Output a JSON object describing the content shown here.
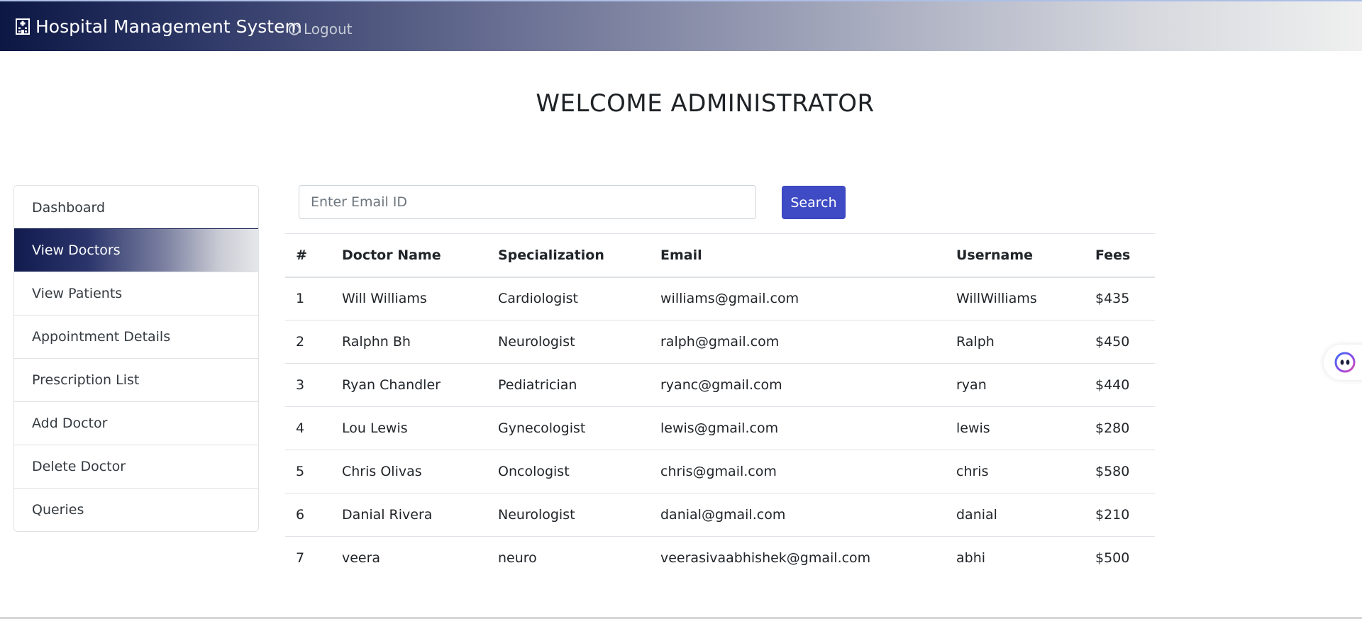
{
  "navbar": {
    "brand": "Hospital Management System",
    "brand_icon": "hospital-icon",
    "logout_label": "Logout",
    "logout_icon": "power-icon"
  },
  "welcome": "WELCOME ADMINISTRATOR",
  "sidebar": {
    "active_index": 1,
    "items": [
      {
        "label": "Dashboard"
      },
      {
        "label": "View Doctors"
      },
      {
        "label": "View Patients"
      },
      {
        "label": "Appointment Details"
      },
      {
        "label": "Prescription List"
      },
      {
        "label": "Add Doctor"
      },
      {
        "label": "Delete Doctor"
      },
      {
        "label": "Queries"
      }
    ]
  },
  "search": {
    "placeholder": "Enter Email ID",
    "value": "",
    "button_label": "Search"
  },
  "table": {
    "headers": [
      "#",
      "Doctor Name",
      "Specialization",
      "Email",
      "Username",
      "Fees"
    ],
    "rows": [
      [
        "1",
        "Will Williams",
        "Cardiologist",
        "williams@gmail.com",
        "WillWilliams",
        "$435"
      ],
      [
        "2",
        "Ralphn Bh",
        "Neurologist",
        "ralph@gmail.com",
        "Ralph",
        "$450"
      ],
      [
        "3",
        "Ryan Chandler",
        "Pediatrician",
        "ryanc@gmail.com",
        "ryan",
        "$440"
      ],
      [
        "4",
        "Lou Lewis",
        "Gynecologist",
        "lewis@gmail.com",
        "lewis",
        "$280"
      ],
      [
        "5",
        "Chris Olivas",
        "Oncologist",
        "chris@gmail.com",
        "chris",
        "$580"
      ],
      [
        "6",
        "Danial Rivera",
        "Neurologist",
        "danial@gmail.com",
        "danial",
        "$210"
      ],
      [
        "7",
        "veera",
        "neuro",
        "veerasivaabhishek@gmail.com",
        "abhi",
        "$500"
      ]
    ]
  },
  "floating_widget": {
    "icon": "assistant-face-icon"
  },
  "colors": {
    "navbar_start": "#0d1744",
    "navbar_end": "#eff0ef",
    "search_button": "#3e4bc4",
    "active_item_start": "#111b4e"
  }
}
